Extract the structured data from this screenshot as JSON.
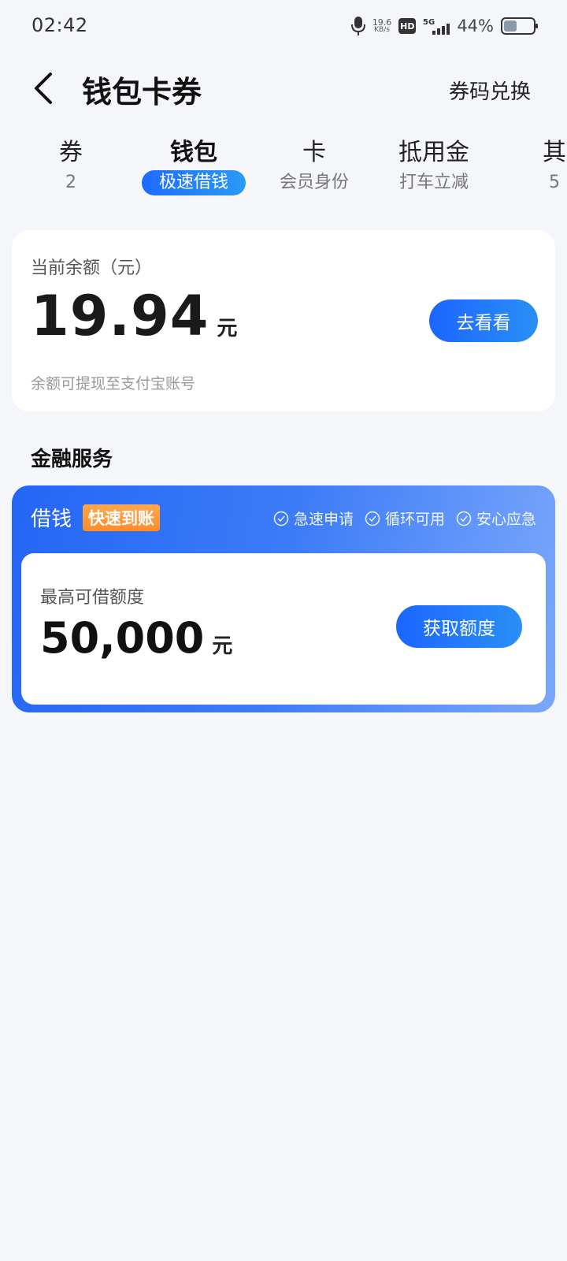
{
  "status_bar": {
    "time": "02:42",
    "net_speed_value": "19.6",
    "net_speed_unit": "KB/s",
    "hd_label": "HD",
    "network": "5G",
    "battery_percent": "44%",
    "battery_level": 0.44
  },
  "header": {
    "back_icon": "chevron-left-icon",
    "title": "钱包卡券",
    "redeem_label": "券码兑换"
  },
  "tabs": [
    {
      "title": "券",
      "sub": "2",
      "active": false
    },
    {
      "title": "钱包",
      "sub": "极速借钱",
      "active": true
    },
    {
      "title": "卡",
      "sub": "会员身份",
      "active": false
    },
    {
      "title": "抵用金",
      "sub": "打车立减",
      "active": false
    },
    {
      "title": "其",
      "sub": "5",
      "active": false
    }
  ],
  "balance": {
    "label": "当前余额（元）",
    "value": "19.94",
    "unit": "元",
    "button_label": "去看看",
    "note": "余额可提现至支付宝账号"
  },
  "finance": {
    "section_title": "金融服务",
    "loan_title": "借钱",
    "badge": "快速到账",
    "features": [
      "急速申请",
      "循环可用",
      "安心应急"
    ],
    "limit_label": "最高可借额度",
    "limit_value": "50,000",
    "limit_unit": "元",
    "button_label": "获取额度"
  },
  "colors": {
    "accent": "#1e6bff",
    "badge_orange": "#ff8a2a",
    "background": "#f4f6f9"
  }
}
